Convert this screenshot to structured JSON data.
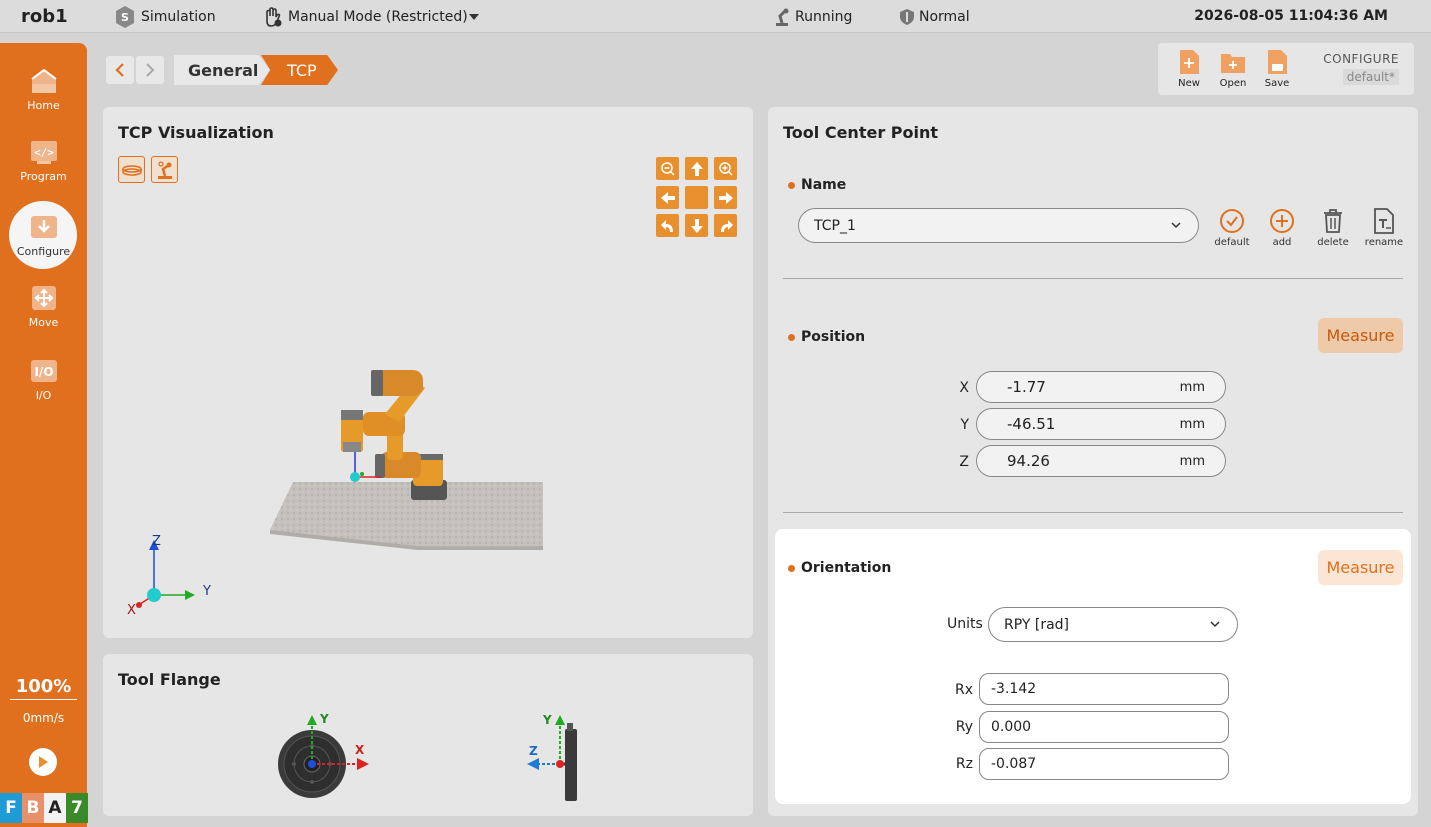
{
  "topbar": {
    "robot_name": "rob1",
    "mode": "Simulation",
    "manual_mode": "Manual Mode (Restricted)",
    "run_state": "Running",
    "safety": "Normal",
    "datetime": "2026-08-05 11:04:36 AM"
  },
  "sidebar": {
    "items": [
      {
        "label": "Home",
        "icon": "home-icon"
      },
      {
        "label": "Program",
        "icon": "code-icon"
      },
      {
        "label": "Configure",
        "icon": "configure-icon"
      },
      {
        "label": "Move",
        "icon": "move-icon"
      },
      {
        "label": "I/O",
        "icon": "io-icon"
      }
    ],
    "active": "Configure",
    "speed_percent": "100%",
    "speed_value": "0mm/s",
    "fba": [
      "F",
      "B",
      "A",
      "7"
    ],
    "fba_colors": [
      "#1f9cd6",
      "#e8906a",
      "#f2f2f2",
      "#3a8a2a"
    ]
  },
  "breadcrumb": {
    "items": [
      "General",
      "TCP"
    ]
  },
  "file": {
    "new": "New",
    "open": "Open",
    "save": "Save",
    "configure_label": "CONFIGURE",
    "configure_value": "default*"
  },
  "visualization": {
    "title": "TCP Visualization",
    "axes": {
      "z": "Z",
      "y": "Y",
      "x": "X"
    }
  },
  "flange": {
    "title": "Tool Flange",
    "front_axes": {
      "y": "Y",
      "x": "X"
    },
    "side_axes": {
      "y": "Y",
      "z": "Z"
    }
  },
  "tcp": {
    "title": "Tool Center Point",
    "name_label": "Name",
    "name_value": "TCP_1",
    "actions": {
      "default": "default",
      "add": "add",
      "delete": "delete",
      "rename": "rename"
    },
    "position_label": "Position",
    "measure_label": "Measure",
    "position": [
      {
        "axis": "X",
        "value": "-1.77",
        "unit": "mm"
      },
      {
        "axis": "Y",
        "value": "-46.51",
        "unit": "mm"
      },
      {
        "axis": "Z",
        "value": "94.26",
        "unit": "mm"
      }
    ],
    "orientation_label": "Orientation",
    "units_label": "Units",
    "units_value": "RPY [rad]",
    "orientation": [
      {
        "axis": "Rx",
        "value": "-3.142"
      },
      {
        "axis": "Ry",
        "value": "0.000"
      },
      {
        "axis": "Rz",
        "value": "-0.087"
      }
    ]
  },
  "colors": {
    "accent": "#e0701e",
    "panel": "#e6e6e6",
    "background": "#d4d4d4"
  }
}
